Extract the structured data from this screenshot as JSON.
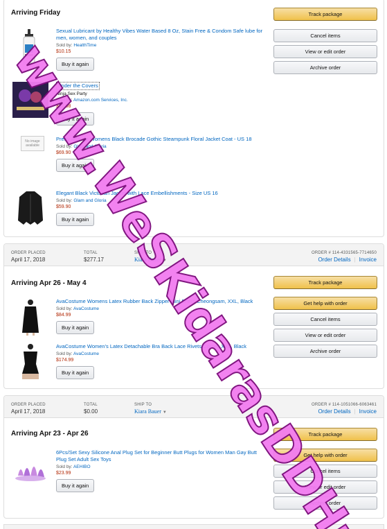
{
  "order1": {
    "shipment_status": "Arriving Friday",
    "actions": [
      "Track package",
      "Cancel items",
      "View or edit order",
      "Archive order"
    ],
    "items": [
      {
        "title": "Sexual Lubricant by Healthy Vibes Water Based 8 Oz, Stain Free & Condom Safe lube for men, women, and couples",
        "sold_by_label": "Sold by:",
        "seller": "HealthTime",
        "price": "$10.15",
        "buy_again": "Buy it again"
      },
      {
        "title": "Under the Covers",
        "subtitle": "Ninja Sex Party",
        "sold_by_label": "Sold by:",
        "seller": "Amazon.com Services, Inc.",
        "price": "$12.98",
        "buy_again": "Buy it again"
      },
      {
        "title": "Pretty Attitude Womens Black Brocade Gothic Steampunk Floral Jacket Coat - US 18",
        "sold_by_label": "Sold by:",
        "seller": "Glam and Gloria",
        "price": "$69.90",
        "buy_again": "Buy it again",
        "no_image_text": "No image available"
      },
      {
        "title": "Elegant Black Victorian Jacket with Lace Embellishments - Size US 16",
        "sold_by_label": "Sold by:",
        "seller": "Glam and Gloria",
        "price": "$59.90",
        "buy_again": "Buy it again"
      }
    ]
  },
  "order2": {
    "header": {
      "placed_label": "ORDER PLACED",
      "placed": "April 17, 2018",
      "total_label": "TOTAL",
      "total": "$277.17",
      "ship_label": "SHIP TO",
      "ship_to": "Kiara Bauer",
      "order_no": "ORDER # 114-4331565-7714650",
      "details": "Order Details",
      "invoice": "Invoice"
    },
    "shipment_status": "Arriving Apr 26 - May 4",
    "actions": [
      "Track package",
      "Get help with order",
      "Cancel items",
      "View or edit order",
      "Archive order"
    ],
    "items": [
      {
        "title": "AvaCostume Womens Latex Rubber Back Zipper Mini Dress Cheongsam, XXL, Black",
        "sold_by_label": "Sold by:",
        "seller": "AvaCostume",
        "price": "$84.99",
        "buy_again": "Buy it again"
      },
      {
        "title": "AvaCostume Women's Latex Detachable Bra Back Lace Rivets Corset, XXL, Black",
        "sold_by_label": "Sold by:",
        "seller": "AvaCostume",
        "price": "$174.99",
        "buy_again": "Buy it again"
      }
    ]
  },
  "order3": {
    "header": {
      "placed_label": "ORDER PLACED",
      "placed": "April 17, 2018",
      "total_label": "TOTAL",
      "total": "$0.00",
      "ship_label": "SHIP TO",
      "ship_to": "Kiara Bauer",
      "order_no": "ORDER # 114-1051066-6063461",
      "details": "Order Details",
      "invoice": "Invoice"
    },
    "shipment_status": "Arriving Apr 23 - Apr 26",
    "actions": [
      "Track package",
      "Get help with order",
      "Cancel items",
      "View or edit order",
      "Archive order"
    ],
    "items": [
      {
        "title": "6Pcs/Set Sexy Silicone Anal Plug Set for Beginner Butt Plugs for Women Man Gay Butt Plug Set Adult Sex Toys",
        "sold_by_label": "Sold by:",
        "seller": "AEHIBO",
        "price": "$23.99",
        "buy_again": "Buy it again"
      }
    ]
  },
  "watermark": "www.WeSKidarasDDHub.com",
  "colors": {
    "link": "#0066c0",
    "price": "#b12704",
    "primary_btn": "#f0c14b",
    "watermark": "#f27cf0"
  }
}
